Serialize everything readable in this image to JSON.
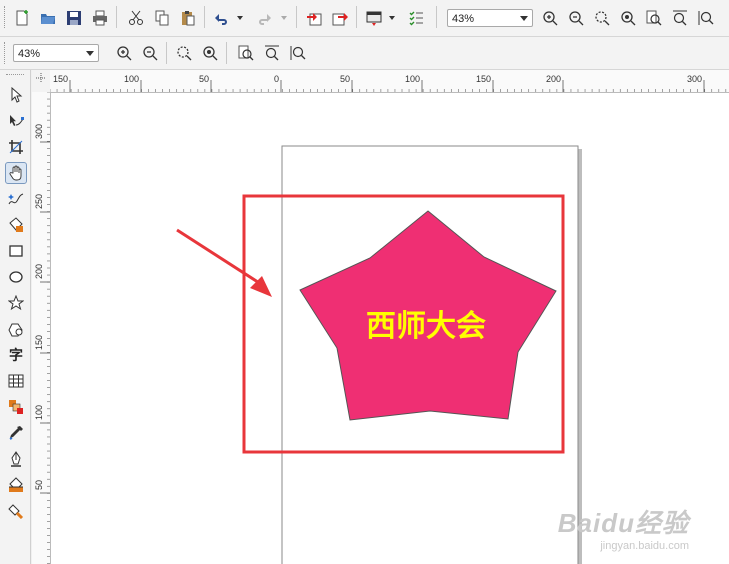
{
  "toolbar_standard": {
    "zoom_value": "43%",
    "icons": [
      "new-icon",
      "open-icon",
      "save-icon",
      "print-icon",
      "cut-icon",
      "copy-icon",
      "paste-icon",
      "undo-icon",
      "redo-icon",
      "import-icon",
      "export-icon",
      "application-launcher-icon",
      "options-icon",
      "zoom-in-icon",
      "zoom-out-icon",
      "zoom-selected-icon",
      "zoom-all-icon",
      "zoom-page-icon",
      "zoom-width-icon",
      "zoom-height-icon"
    ]
  },
  "toolbar_zoom": {
    "zoom_value": "43%"
  },
  "toolbox": {
    "tools": [
      "pick-tool",
      "shape-tool",
      "crop-tool",
      "pan-tool",
      "freehand-tool",
      "smart-fill-tool",
      "rectangle-tool",
      "ellipse-tool",
      "polygon-tool",
      "basic-shapes-tool",
      "text-tool",
      "table-tool",
      "interactive-blend-tool",
      "eyedropper-tool",
      "outline-tool",
      "fill-tool",
      "interactive-fill-tool"
    ],
    "active_tool": "pan-tool",
    "text_tool_glyph": "字"
  },
  "ruler_horizontal": {
    "labels": [
      "150",
      "100",
      "50",
      "0",
      "50",
      "100",
      "150",
      "200",
      "300"
    ]
  },
  "ruler_vertical": {
    "labels": [
      "300",
      "250",
      "200",
      "150",
      "100",
      "50"
    ]
  },
  "document": {
    "shape_text": "西师大会",
    "shape_fill": "#ef2f73",
    "text_color": "#ffff00",
    "highlight_box_color": "#e8363b",
    "arrow_color": "#e8363b"
  },
  "watermark": {
    "brand": "Baidu经验",
    "url": "jingyan.baidu.com"
  }
}
